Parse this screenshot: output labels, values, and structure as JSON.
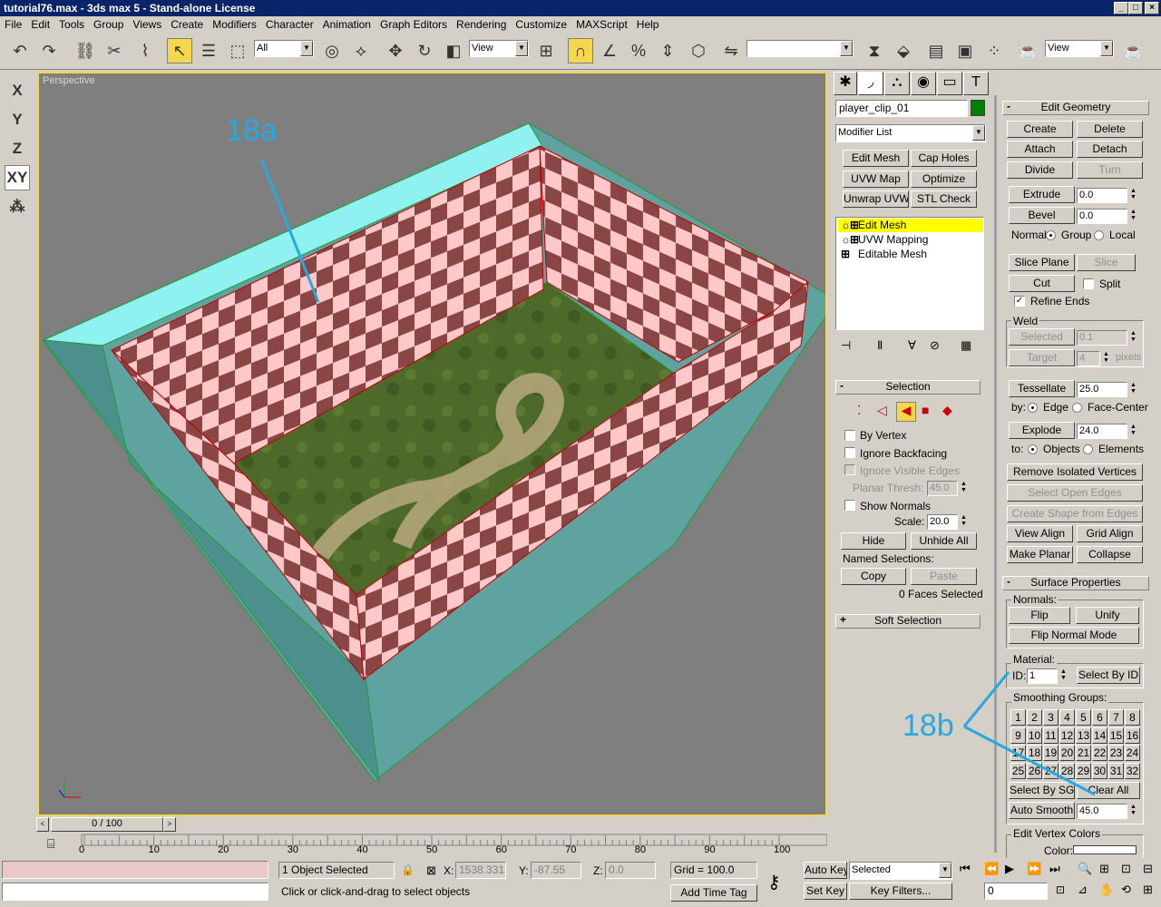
{
  "window": {
    "title": "tutorial76.max - 3ds max 5 - Stand-alone License"
  },
  "menu": [
    "File",
    "Edit",
    "Tools",
    "Group",
    "Views",
    "Create",
    "Modifiers",
    "Character",
    "Animation",
    "Graph Editors",
    "Rendering",
    "Customize",
    "MAXScript",
    "Help"
  ],
  "toolbar": {
    "filter_value": "All",
    "coord_value": "View",
    "named_sel_value": "",
    "render_view_value": "View"
  },
  "axis_buttons": [
    "X",
    "Y",
    "Z",
    "XY"
  ],
  "viewport": {
    "label": "Perspective"
  },
  "callouts": {
    "a": "18a",
    "b": "18b"
  },
  "timeline": {
    "position": "0 / 100",
    "ticks": [
      "0",
      "10",
      "20",
      "30",
      "40",
      "50",
      "60",
      "70",
      "80",
      "90",
      "100"
    ]
  },
  "command_panel": {
    "object_name": "player_clip_01",
    "object_color": "#008000",
    "modifier_list": "Modifier List",
    "modifier_buttons": [
      "Edit Mesh",
      "Cap Holes",
      "UVW Map",
      "Optimize",
      "Unwrap UVW",
      "STL Check"
    ],
    "stack": [
      "Edit Mesh",
      "UVW Mapping",
      "Editable Mesh"
    ],
    "selection": {
      "title": "Selection",
      "by_vertex": "By Vertex",
      "ignore_backfacing": "Ignore Backfacing",
      "ignore_visible_edges": "Ignore Visible Edges",
      "planar_thresh_label": "Planar Thresh:",
      "planar_thresh_value": "45.0",
      "show_normals": "Show Normals",
      "scale_label": "Scale:",
      "scale_value": "20.0",
      "hide": "Hide",
      "unhide_all": "Unhide All",
      "named_selections": "Named Selections:",
      "copy": "Copy",
      "paste": "Paste",
      "faces_selected": "0 Faces Selected"
    },
    "soft_selection": "Soft Selection",
    "edit_geometry": {
      "title": "Edit Geometry",
      "create": "Create",
      "delete": "Delete",
      "attach": "Attach",
      "detach": "Detach",
      "divide": "Divide",
      "turn": "Turn",
      "extrude": "Extrude",
      "extrude_value": "0.0",
      "bevel": "Bevel",
      "bevel_value": "0.0",
      "normal_label": "Normal:",
      "group": "Group",
      "local": "Local",
      "slice_plane": "Slice Plane",
      "slice": "Slice",
      "cut": "Cut",
      "split": "Split",
      "refine_ends": "Refine Ends",
      "weld": "Weld",
      "selected": "Selected",
      "selected_value": "0.1",
      "target": "Target",
      "target_value": "4",
      "pixels": "pixels",
      "tessellate": "Tessellate",
      "tessellate_value": "25.0",
      "by_label": "by:",
      "edge": "Edge",
      "face_center": "Face-Center",
      "explode": "Explode",
      "explode_value": "24.0",
      "to_label": "to:",
      "objects": "Objects",
      "elements": "Elements",
      "remove_isolated": "Remove Isolated Vertices",
      "select_open_edges": "Select Open Edges",
      "create_shape": "Create Shape from Edges",
      "view_align": "View Align",
      "grid_align": "Grid Align",
      "make_planar": "Make Planar",
      "collapse": "Collapse"
    },
    "surface_properties": {
      "title": "Surface Properties",
      "normals": "Normals:",
      "flip": "Flip",
      "unify": "Unify",
      "flip_normal_mode": "Flip Normal Mode",
      "material": "Material:",
      "id_label": "ID:",
      "id_value": "1",
      "select_by_id": "Select By ID",
      "smoothing_groups": "Smoothing Groups:",
      "sg": [
        "1",
        "2",
        "3",
        "4",
        "5",
        "6",
        "7",
        "8",
        "9",
        "10",
        "11",
        "12",
        "13",
        "14",
        "15",
        "16",
        "17",
        "18",
        "19",
        "20",
        "21",
        "22",
        "23",
        "24",
        "25",
        "26",
        "27",
        "28",
        "29",
        "30",
        "31",
        "32"
      ],
      "select_by_sg": "Select By SG",
      "clear_all": "Clear All",
      "auto_smooth": "Auto Smooth",
      "auto_smooth_value": "45.0",
      "edit_vertex_colors": "Edit Vertex Colors",
      "color_label": "Color:"
    }
  },
  "status": {
    "selection": "1 Object Selected",
    "prompt": "Click or click-and-drag to select objects",
    "x_label": "X:",
    "x_value": "1538.331",
    "y_label": "Y:",
    "y_value": "-87.55",
    "z_label": "Z:",
    "z_value": "0.0",
    "grid": "Grid = 100.0",
    "add_time_tag": "Add Time Tag",
    "auto_key": "Auto Key",
    "set_key": "Set Key",
    "key_mode": "Selected",
    "key_filters": "Key Filters...",
    "frame": "0"
  }
}
